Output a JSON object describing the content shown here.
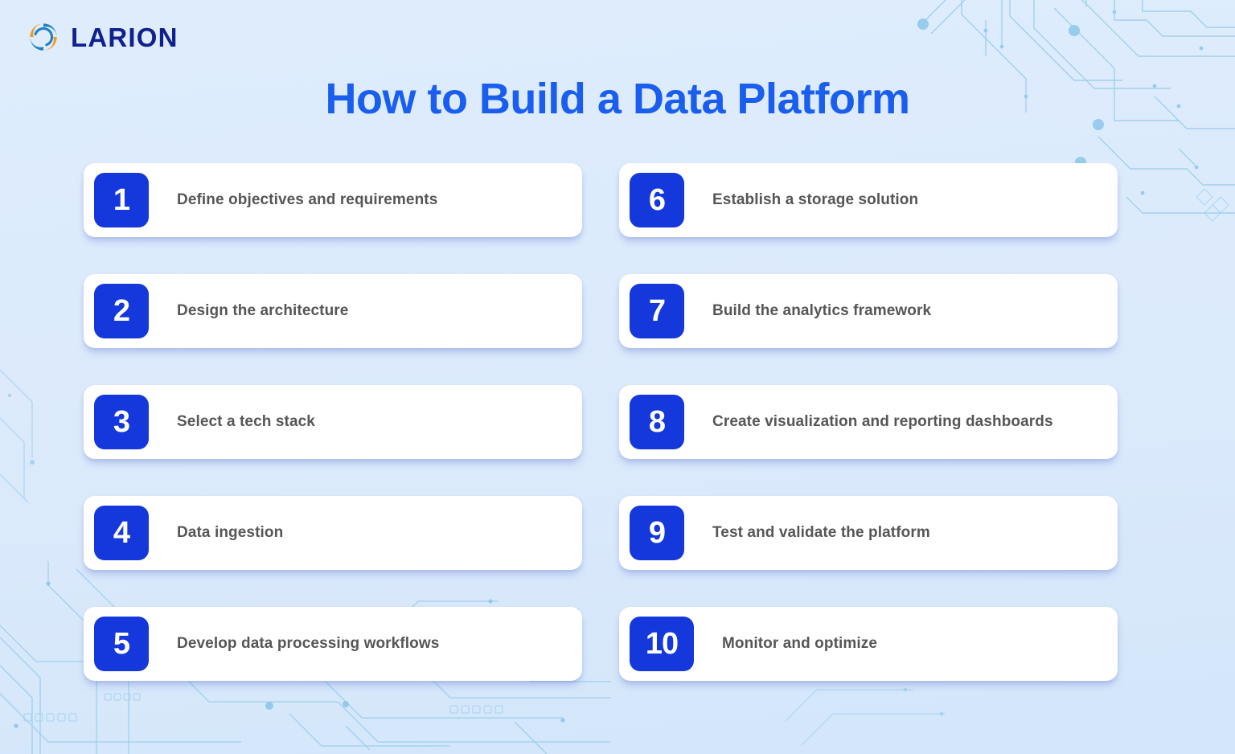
{
  "brand": {
    "logo_icon": "larion-swirl-icon",
    "name": "LARION",
    "mark_color_blue": "#1f7fc2",
    "mark_color_orange": "#ee9a22",
    "text_color": "#10208e"
  },
  "header": {
    "title": "How to Build a Data Platform",
    "title_color": "#1a5ef0"
  },
  "theme": {
    "background": "#dbeafb",
    "card_background": "#ffffff",
    "badge_color": "#1438dc",
    "label_color": "#565656",
    "circuit_line_color": "#7cc0e8"
  },
  "steps": [
    {
      "number": "1",
      "label": "Define objectives and requirements"
    },
    {
      "number": "2",
      "label": "Design the architecture"
    },
    {
      "number": "3",
      "label": "Select a tech stack"
    },
    {
      "number": "4",
      "label": "Data ingestion"
    },
    {
      "number": "5",
      "label": "Develop data processing workflows"
    },
    {
      "number": "6",
      "label": "Establish a storage solution"
    },
    {
      "number": "7",
      "label": "Build the analytics framework"
    },
    {
      "number": "8",
      "label": "Create visualization and reporting dashboards"
    },
    {
      "number": "9",
      "label": "Test and validate the platform"
    },
    {
      "number": "10",
      "label": "Monitor and optimize"
    }
  ]
}
